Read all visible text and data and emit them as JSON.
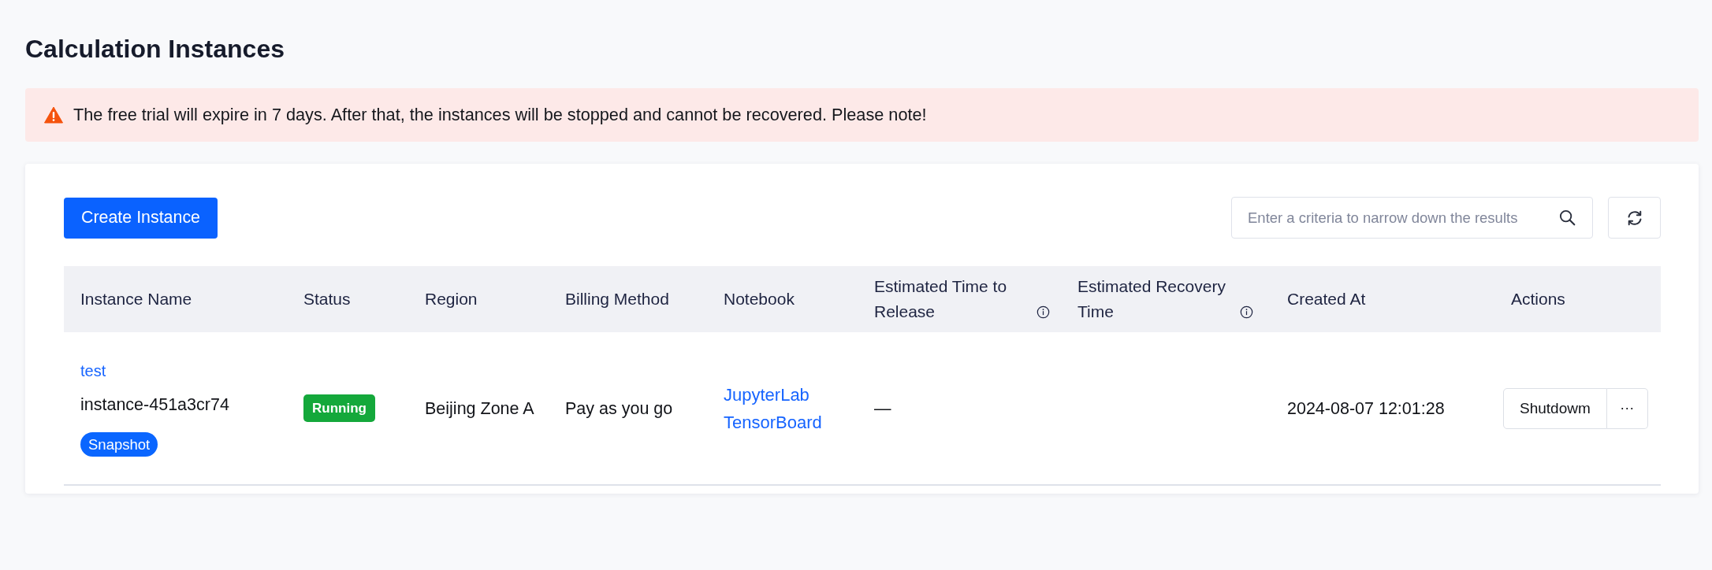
{
  "page": {
    "title": "Calculation Instances"
  },
  "alert": {
    "kind": "warning",
    "text": "The free trial will expire in 7 days. After that, the instances will be stopped and cannot be recovered. Please note!"
  },
  "toolbar": {
    "create_button": {
      "label": "Create Instance"
    },
    "search": {
      "placeholder": "Enter a criteria to narrow down the results"
    }
  },
  "table": {
    "columns": [
      {
        "label": "Instance Name",
        "info": false
      },
      {
        "label": "Status",
        "info": false
      },
      {
        "label": "Region",
        "info": false
      },
      {
        "label": "Billing Method",
        "info": false
      },
      {
        "label": "Notebook",
        "info": false
      },
      {
        "label": "Estimated Time to Release",
        "info": true
      },
      {
        "label": "Estimated Recovery Time",
        "info": true
      },
      {
        "label": "Created At",
        "info": false
      },
      {
        "label": "Actions",
        "info": false
      }
    ],
    "rows": [
      {
        "display_name": "test",
        "name": "instance-451a3cr74",
        "tag": "Snapshot",
        "status": {
          "label": "Running",
          "color": "#14a83b"
        },
        "region": "Beijing Zone A",
        "billing": "Pay as you go",
        "notebooks": [
          "JupyterLab",
          "TensorBoard"
        ],
        "release_time": "—",
        "created_at": "2024-08-07 12:01:28",
        "actions": [
          {
            "kind": "button",
            "label": "Shutdowm"
          },
          {
            "kind": "more",
            "label": "···"
          }
        ]
      }
    ]
  }
}
